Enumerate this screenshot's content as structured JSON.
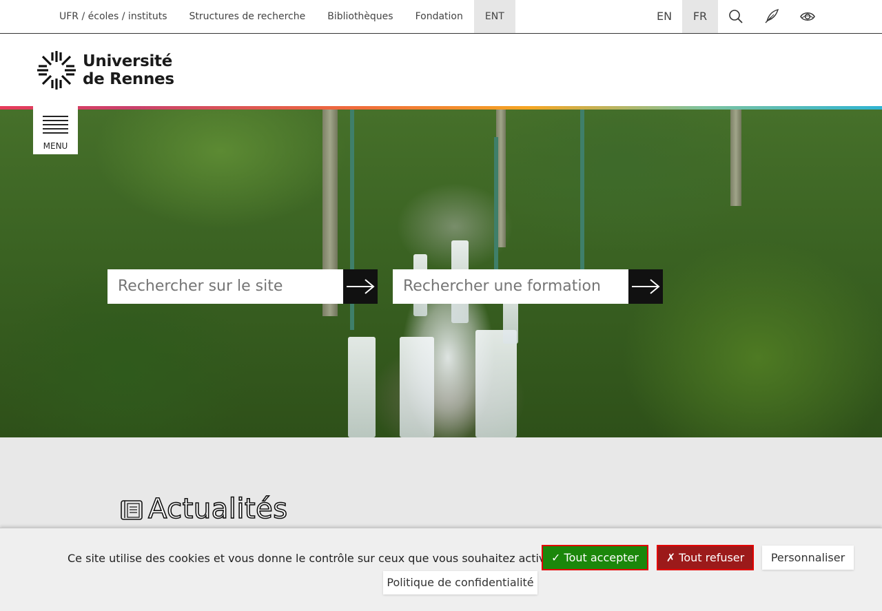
{
  "topnav": {
    "items": [
      "UFR / écoles / instituts",
      "Structures de recherche",
      "Bibliothèques",
      "Fondation",
      "ENT"
    ]
  },
  "tools": {
    "languages": [
      "EN",
      "FR"
    ],
    "active_language": "FR",
    "icons": [
      "search-icon",
      "feather-icon",
      "eye-icon"
    ]
  },
  "header": {
    "logo_line1": "Université",
    "logo_line2": "de Rennes"
  },
  "menu": {
    "label": "MENU"
  },
  "hero": {
    "search_site_placeholder": "Rechercher sur le site",
    "search_formation_placeholder": "Rechercher une formation"
  },
  "news": {
    "title": "Actualités"
  },
  "cookie": {
    "message": "Ce site utilise des cookies et vous donne le contrôle sur ceux que vous souhaitez activer",
    "accept": "✓ Tout accepter",
    "refuse": "✗ Tout refuser",
    "customize": "Personnaliser",
    "policy": "Politique de confidentialité"
  },
  "colors": {
    "accept_bg": "#1b870b",
    "refuse_bg": "#9c1a1a",
    "button_border": "#e30000",
    "band_bg": "#e8e8e8"
  }
}
